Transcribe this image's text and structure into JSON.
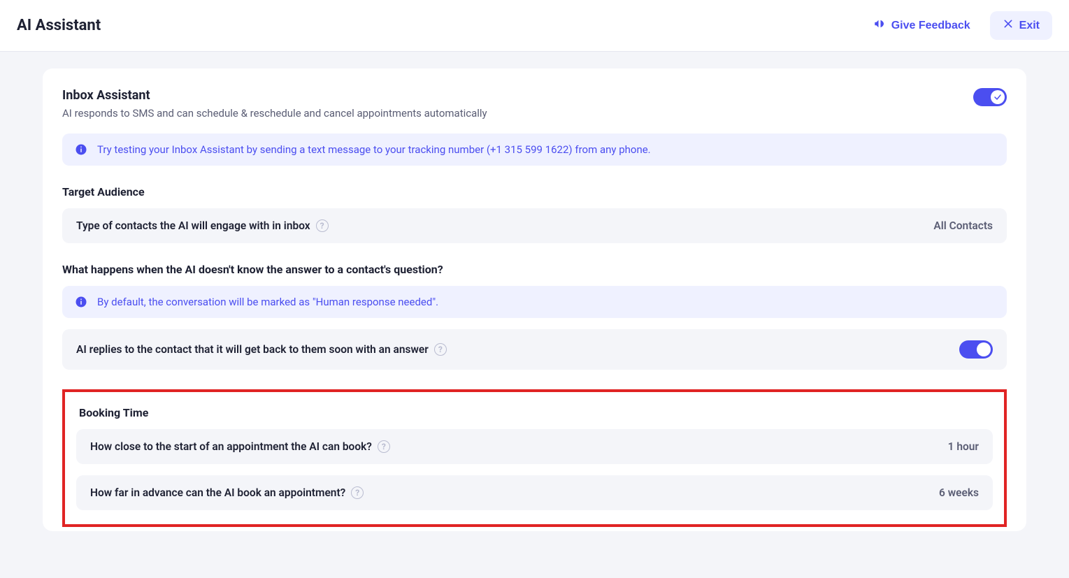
{
  "header": {
    "title": "AI Assistant",
    "feedback_label": "Give Feedback",
    "exit_label": "Exit"
  },
  "inbox_assistant": {
    "title": "Inbox Assistant",
    "subtitle": "AI responds to SMS and can schedule & reschedule and cancel appointments automatically",
    "toggle_on": true,
    "info_banner": "Try testing your Inbox Assistant by sending a text message to your tracking number (+1 315 599 1622) from any phone."
  },
  "target_audience": {
    "heading": "Target Audience",
    "row_label": "Type of contacts the AI will engage with in inbox",
    "row_value": "All Contacts"
  },
  "fallback": {
    "heading": "What happens when the AI doesn't know the answer to a contact's question?",
    "info_banner": "By default, the conversation will be marked as \"Human response needed\".",
    "reply_row_label": "AI replies to the contact that it will get back to them soon with an answer",
    "reply_toggle_on": true
  },
  "booking_time": {
    "heading": "Booking Time",
    "close_label": "How close to the start of an appointment the AI can book?",
    "close_value": "1 hour",
    "advance_label": "How far in advance can the AI book an appointment?",
    "advance_value": "6 weeks"
  }
}
